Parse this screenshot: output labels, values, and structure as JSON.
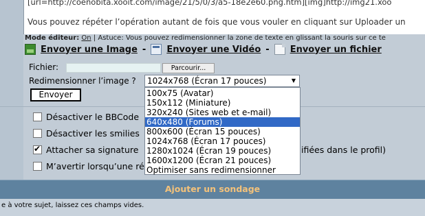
{
  "editor": {
    "line1": "[url=http://coenobita.xooit.com/image/21/5/0/3/a5-18e2e60.png.htm][img]http://img21.xoo",
    "line2": "Vous pouvez répéter l’opération autant de fois que vous vouler en cliquant sur Uploader un"
  },
  "mode": {
    "label": "Mode éditeur:",
    "value": "On",
    "tip": "| Astuce: Vous pouvez redimensionner la zone de texte en glissant la souris sur ce te"
  },
  "uploads": {
    "image": "Envoyer une Image",
    "video": "Envoyer une Vidéo",
    "file": "Envoyer un fichier",
    "separator": "-"
  },
  "form": {
    "file_label": "Fichier:",
    "browse_label": "Parcourir...",
    "resize_label": "Redimensionner l’image ?",
    "selected": "1024x768 (Écran 17 pouces)",
    "send_label": "Envoyer"
  },
  "dropdown": {
    "options": [
      "100x75 (Avatar)",
      "150x112 (Miniature)",
      "320x240 (Sites web et e-mail)",
      "640x480 (Forums)",
      "800x600 (Écran 15 pouces)",
      "1024x768 (Écran 17 pouces)",
      "1280x1024 (Écran 19 pouces)",
      "1600x1200 (Écran 21 pouces)",
      "Optimiser sans redimensionner"
    ],
    "highlighted_index": 3
  },
  "options": {
    "bbcode": "Désactiver le BBCode",
    "smilies": "Désactiver les smilies",
    "signature_left": "Attacher sa signature",
    "signature_right": "ifiées dans le profil)",
    "notify": "M’avertir lorsqu’une ré",
    "signature_checked": true
  },
  "poll": {
    "title": "Ajouter un sondage"
  },
  "footer": {
    "note": "e à votre sujet, laissez ces champs vides."
  },
  "colors": {
    "highlight": "#3169c6",
    "poll_bar": "#5e829f",
    "poll_text": "#f4c27a"
  }
}
